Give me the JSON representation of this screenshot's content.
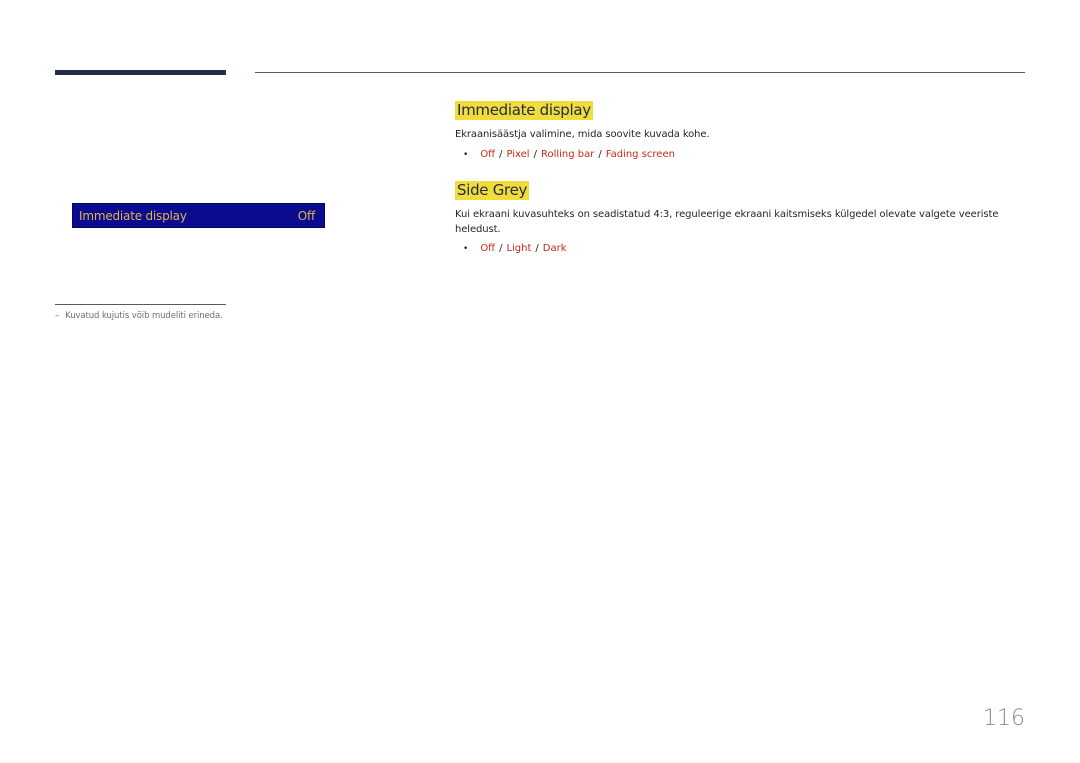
{
  "header": {
    "decorative_rules": true
  },
  "menu_preview": {
    "label": "Immediate display",
    "value": "Off"
  },
  "footnote": {
    "dash": "–",
    "text": "Kuvatud kujutis võib mudeliti erineda."
  },
  "sections": [
    {
      "title": "Immediate display",
      "description": "Ekraanisäästja valimine, mida soovite kuvada kohe.",
      "bullet": "•",
      "options": [
        "Off",
        "Pixel",
        "Rolling bar",
        "Fading screen"
      ]
    },
    {
      "title": "Side Grey",
      "description": "Kui ekraani kuvasuhteks on seadistatud 4:3, reguleerige ekraani kaitsmiseks külgedel olevate valgete veeriste heledust.",
      "bullet": "•",
      "options": [
        "Off",
        "Light",
        "Dark"
      ]
    }
  ],
  "option_separator": "/",
  "colors": {
    "heading_highlight": "#f0dc3a",
    "option_text": "#c8281a",
    "menu_bg": "#0b0b8f",
    "menu_text": "#e0b24c"
  },
  "page_number": "116"
}
